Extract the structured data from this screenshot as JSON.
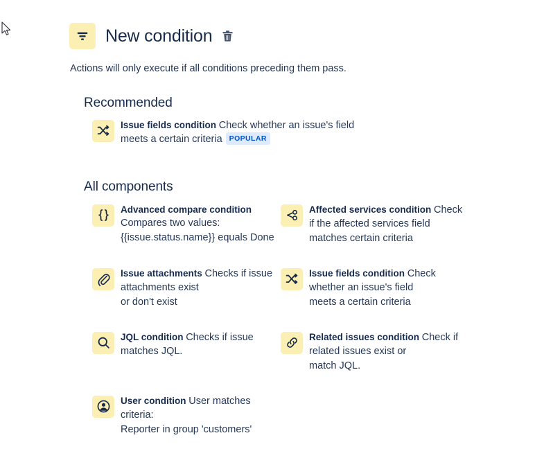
{
  "header": {
    "icon": "filter-icon",
    "title": "New condition",
    "delete_icon": "trash-icon",
    "subtitle": "Actions will only execute if all conditions preceding them pass."
  },
  "sections": {
    "recommended_heading": "Recommended",
    "all_components_heading": "All components"
  },
  "recommended": [
    {
      "icon": "shuffle-icon",
      "title": "Issue fields condition",
      "desc_line1": "Check whether an issue's field",
      "desc_line2": "meets a certain criteria",
      "badge": "POPULAR"
    }
  ],
  "all_components": [
    {
      "icon": "curly-braces-icon",
      "title": "Advanced compare condition",
      "desc_line1": "Compares two values:",
      "desc_line2": "{{issue.status.name}} equals Done",
      "badge": ""
    },
    {
      "icon": "affected-services-node-icon",
      "title": "Affected services condition",
      "desc_line1": "Check if the affected services field",
      "desc_line2": "matches certain criteria",
      "badge": ""
    },
    {
      "icon": "paperclip-icon",
      "title": "Issue attachments",
      "desc_line1": "Checks if issue attachments exist",
      "desc_line2": "or don't exist",
      "badge": ""
    },
    {
      "icon": "shuffle-icon",
      "title": "Issue fields condition",
      "desc_line1": "Check whether an issue's field",
      "desc_line2": "meets a certain criteria",
      "badge": ""
    },
    {
      "icon": "search-icon",
      "title": "JQL condition",
      "desc_line1": "Checks if issue matches JQL.",
      "desc_line2": "",
      "badge": ""
    },
    {
      "icon": "link-icon",
      "title": "Related issues condition",
      "desc_line1": "Check if related issues exist or",
      "desc_line2": "match JQL.",
      "badge": ""
    },
    {
      "icon": "user-avatar-icon",
      "title": "User condition",
      "desc_line1": "User matches criteria:",
      "desc_line2": "Reporter in group 'customers'",
      "badge": ""
    }
  ],
  "colors": {
    "icon_background": "#FCEFB4",
    "icon_glyph": "#172B4D",
    "text_primary": "#172B4D",
    "text_secondary": "#253858",
    "badge_background": "#DEEBFF",
    "badge_text": "#0052CC",
    "trash": "#42526E"
  }
}
